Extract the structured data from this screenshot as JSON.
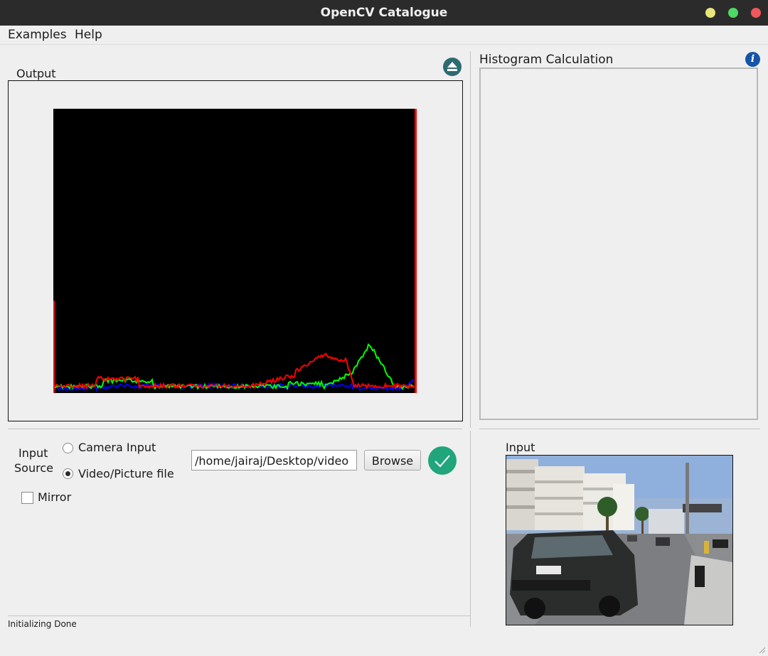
{
  "window": {
    "title": "OpenCV Catalogue",
    "controls": {
      "minimize_color": "#e8e57a",
      "maximize_color": "#4dd964",
      "close_color": "#f0575a"
    }
  },
  "menu": {
    "items": [
      "Examples",
      "Help"
    ]
  },
  "output_panel": {
    "label": "Output",
    "eject_icon": "eject-icon"
  },
  "histogram_panel": {
    "title": "Histogram Calculation",
    "info_icon": "info-icon",
    "info_glyph": "i"
  },
  "input_source": {
    "label_line1": "Input",
    "label_line2": "Source",
    "options": [
      {
        "label": "Camera Input",
        "selected": false
      },
      {
        "label": "Video/Picture file",
        "selected": true
      }
    ],
    "mirror_label": "Mirror",
    "mirror_checked": false,
    "file_path": "/home/jairaj/Desktop/video",
    "browse_label": "Browse",
    "apply_icon": "checkmark-icon"
  },
  "input_preview": {
    "label": "Input"
  },
  "status_bar": {
    "text": "Initializing Done"
  },
  "colors": {
    "window_bg": "#efefef",
    "titlebar_bg": "#2b2b2b",
    "apply_green": "#21a57a",
    "eject_teal": "#2d6b73",
    "info_blue": "#1654a8",
    "hist_red": "#ff0000",
    "hist_green": "#00ff00",
    "hist_blue": "#0000ff"
  }
}
